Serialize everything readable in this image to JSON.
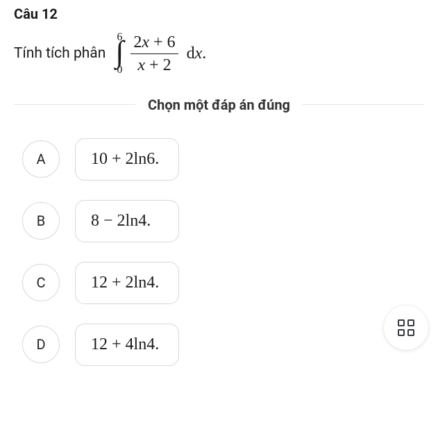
{
  "question": {
    "title": "Câu 12",
    "stem_prefix": "Tính tích phân",
    "integral": {
      "upper": "6",
      "lower": "0",
      "numerator": "2x + 6",
      "denominator": "x + 2",
      "diff": "dx."
    }
  },
  "instruction": "Chọn một đáp án đúng",
  "options": [
    {
      "letter": "A",
      "text": "10 + 2ln6."
    },
    {
      "letter": "B",
      "text": "8 − 2ln4."
    },
    {
      "letter": "C",
      "text": "12 + 2ln4."
    },
    {
      "letter": "D",
      "text": "12 + 4ln4."
    }
  ],
  "fab_name": "grid-menu"
}
